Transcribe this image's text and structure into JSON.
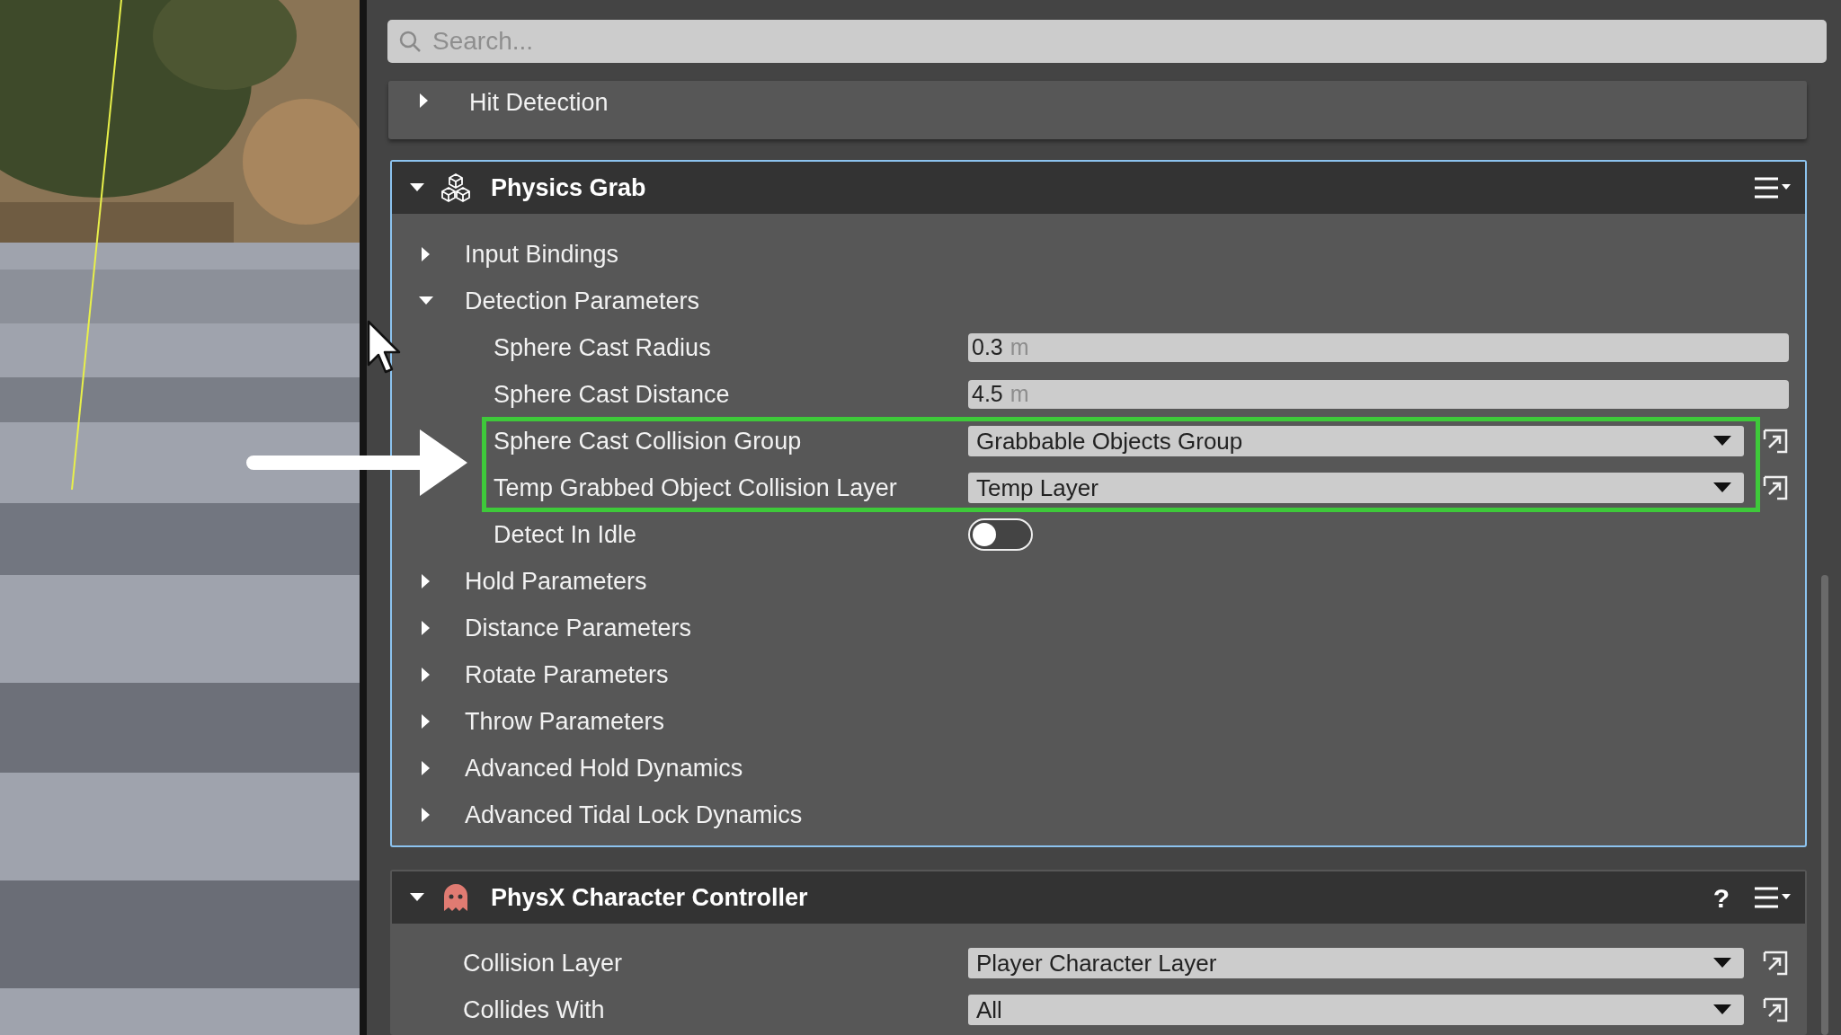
{
  "search": {
    "placeholder": "Search..."
  },
  "sections": [
    {
      "kind": "group",
      "title": "Hit Detection",
      "expanded": false
    },
    {
      "kind": "component",
      "title": "Physics Grab",
      "expanded": true,
      "selected": true,
      "rows": [
        {
          "kind": "group",
          "label": "Input Bindings",
          "expanded": false
        },
        {
          "kind": "group",
          "label": "Detection Parameters",
          "expanded": true,
          "children": [
            {
              "kind": "number",
              "label": "Sphere Cast Radius",
              "value": "0.3",
              "unit": "m"
            },
            {
              "kind": "number",
              "label": "Sphere Cast Distance",
              "value": "4.5",
              "unit": "m"
            },
            {
              "kind": "dropdown",
              "label": "Sphere Cast Collision Group",
              "value": "Grabbable Objects Group",
              "highlighted": true
            },
            {
              "kind": "dropdown",
              "label": "Temp Grabbed Object Collision Layer",
              "value": "Temp Layer",
              "highlighted": true
            },
            {
              "kind": "toggle",
              "label": "Detect In Idle",
              "on": false
            }
          ]
        },
        {
          "kind": "group",
          "label": "Hold Parameters",
          "expanded": false
        },
        {
          "kind": "group",
          "label": "Distance Parameters",
          "expanded": false
        },
        {
          "kind": "group",
          "label": "Rotate Parameters",
          "expanded": false
        },
        {
          "kind": "group",
          "label": "Throw Parameters",
          "expanded": false
        },
        {
          "kind": "group",
          "label": "Advanced Hold Dynamics",
          "expanded": false
        },
        {
          "kind": "group",
          "label": "Advanced Tidal Lock Dynamics",
          "expanded": false
        }
      ]
    },
    {
      "kind": "component",
      "title": "PhysX Character Controller",
      "expanded": true,
      "selected": false,
      "help": "?",
      "rows": [
        {
          "kind": "dropdown",
          "label": "Collision Layer",
          "value": "Player Character Layer"
        },
        {
          "kind": "dropdown",
          "label": "Collides With",
          "value": "All"
        }
      ]
    }
  ]
}
